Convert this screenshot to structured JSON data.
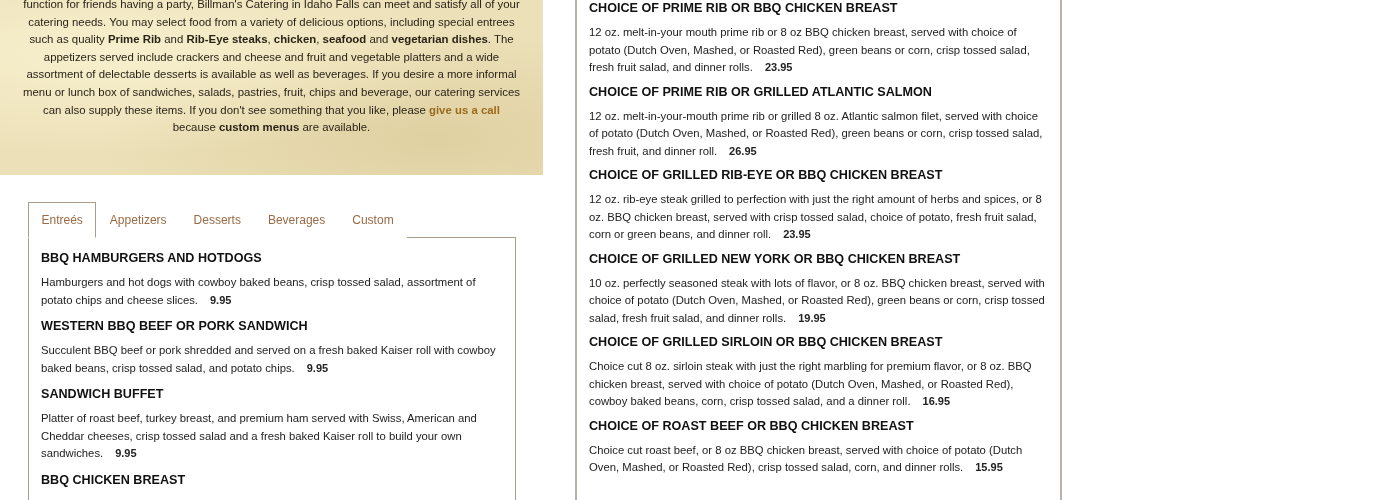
{
  "intro": {
    "before": "function for friends having a party, Billman's Catering in Idaho Falls can meet and satisfy all of your catering needs. You may select food from a variety of delicious options, including special entrees such as quality **Prime Rib** and **Rib-Eye steaks**, **chicken**, **seafood** and **vegetarian dishes**. The appetizers served include crackers and cheese and fruit and vegetable platters and a wide assortment of delectable desserts is available as well as beverages. If you desire a more informal menu or lunch box of sandwiches, salads, pastries, fruit, chips and beverage, our catering services can also supply these items. If you don't see something that you like, please ",
    "link": "give us a call",
    "after": " because **custom menus** are available."
  },
  "tabs": [
    {
      "label": "Entreés",
      "selected": true
    },
    {
      "label": "Appetizers",
      "selected": false
    },
    {
      "label": "Desserts",
      "selected": false
    },
    {
      "label": "Beverages",
      "selected": false
    },
    {
      "label": "Custom",
      "selected": false
    }
  ],
  "left_items": [
    {
      "name": "BBQ HAMBURGERS AND HOTDOGS",
      "description": "Hamburgers and hot dogs with cowboy baked beans, crisp tossed salad, assortment of potato chips and cheese slices.",
      "price": "9.95"
    },
    {
      "name": "WESTERN BBQ BEEF OR PORK SANDWICH",
      "description": "Succulent BBQ beef or pork shredded and served on a fresh baked Kaiser roll with cowboy baked beans, crisp tossed salad, and potato chips.",
      "price": "9.95"
    },
    {
      "name": "SANDWICH BUFFET",
      "description": "Platter of roast beef, turkey breast, and premium ham served with Swiss, American and Cheddar cheeses, crisp tossed salad and a fresh baked Kaiser roll to build your own sandwiches.",
      "price": "9.95"
    },
    {
      "name": "BBQ CHICKEN BREAST"
    }
  ],
  "right_items": [
    {
      "name": "CHOICE OF PRIME RIB OR BBQ CHICKEN BREAST",
      "description": "12 oz. melt-in-your mouth prime rib or 8 oz BBQ chicken breast, served with choice of potato (Dutch Oven, Mashed, or Roasted Red), green beans or corn, crisp tossed salad, fresh fruit salad, and dinner rolls.",
      "price": "23.95"
    },
    {
      "name": "CHOICE OF PRIME RIB OR GRILLED ATLANTIC SALMON",
      "description": "12 oz. melt-in-your-mouth prime rib or grilled 8 oz. Atlantic salmon filet, served with choice of potato (Dutch Oven, Mashed, or Roasted Red), green beans or corn, crisp tossed salad, fresh fruit, and dinner roll.",
      "price": "26.95"
    },
    {
      "name": "CHOICE OF GRILLED RIB-EYE OR BBQ CHICKEN BREAST",
      "description": "12 oz. rib-eye steak grilled to perfection with just the right amount of herbs and spices, or 8 oz. BBQ chicken breast, served with crisp tossed salad, choice of potato, fresh fruit salad, corn or green beans, and dinner roll.",
      "price": "23.95"
    },
    {
      "name": "CHOICE OF GRILLED NEW YORK OR BBQ CHICKEN BREAST",
      "description": "10 oz. perfectly seasoned steak with lots of flavor, or 8 oz. BBQ chicken breast, served with choice of potato (Dutch Oven, Mashed, or Roasted Red), green beans or corn, crisp tossed salad, fresh fruit salad, and dinner rolls.",
      "price": "19.95"
    },
    {
      "name": "CHOICE OF GRILLED SIRLOIN OR BBQ CHICKEN BREAST",
      "description": "Choice cut 8 oz. sirloin steak with just the right marbling for premium flavor, or 8 oz. BBQ chicken breast, served with choice of potato (Dutch Oven, Mashed, or Roasted Red), cowboy baked beans, corn, crisp tossed salad, and a dinner roll.",
      "price": "16.95"
    },
    {
      "name": "CHOICE OF ROAST BEEF OR BBQ CHICKEN BREAST",
      "description": "Choice cut roast beef, or 8 oz BBQ chicken breast, served with choice of potato (Dutch Oven, Mashed, or Roasted Red), crisp tossed salad, corn, and dinner rolls.",
      "price": "15.95"
    }
  ]
}
